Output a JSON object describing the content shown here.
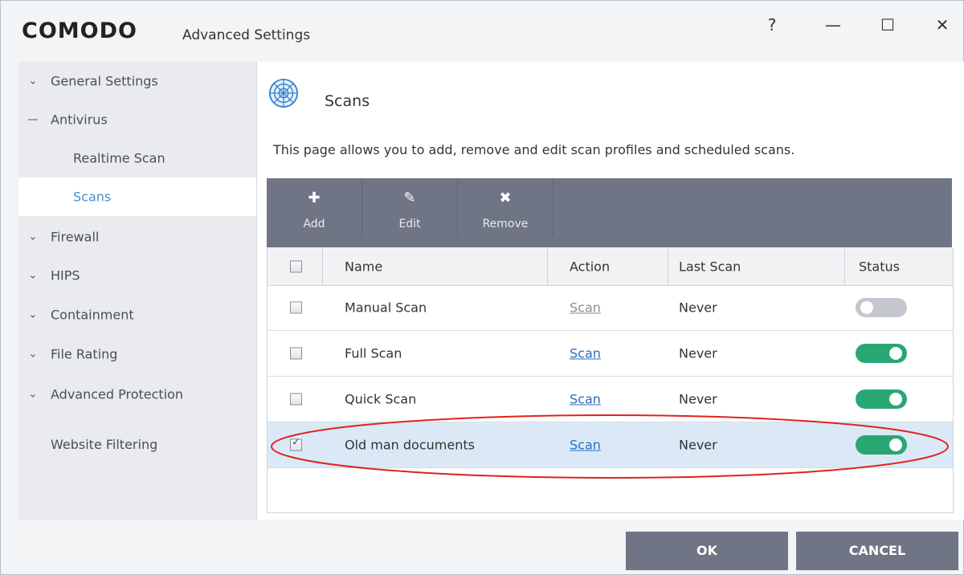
{
  "window": {
    "logo": "COMODO",
    "subtitle": "Advanced Settings",
    "controls": {
      "help": "?",
      "minimize": "—",
      "maximize": "☐",
      "close": "✕"
    }
  },
  "sidebar": {
    "items": [
      {
        "label": "General Settings",
        "icon": "chevron-down-icon",
        "glyph": "⌄"
      },
      {
        "label": "Antivirus",
        "icon": "collapse-dash-icon",
        "glyph": "—"
      },
      {
        "label": "Realtime Scan"
      },
      {
        "label": "Scans"
      },
      {
        "label": "Firewall",
        "icon": "chevron-down-icon",
        "glyph": "⌄"
      },
      {
        "label": "HIPS",
        "icon": "chevron-down-icon",
        "glyph": "⌄"
      },
      {
        "label": "Containment",
        "icon": "chevron-down-icon",
        "glyph": "⌄"
      },
      {
        "label": "File Rating",
        "icon": "chevron-down-icon",
        "glyph": "⌄"
      },
      {
        "label": "Advanced Protection",
        "icon": "chevron-down-icon",
        "glyph": "⌄"
      },
      {
        "label": "Website Filtering"
      }
    ],
    "active": "Scans"
  },
  "main": {
    "title": "Scans",
    "description": "This page allows you to add, remove and edit scan profiles and scheduled scans.",
    "toolbar": [
      {
        "label": "Add",
        "icon": "plus-icon",
        "glyph": "✚"
      },
      {
        "label": "Edit",
        "icon": "pencil-icon",
        "glyph": "✎"
      },
      {
        "label": "Remove",
        "icon": "x-icon",
        "glyph": "✖"
      }
    ],
    "table": {
      "columns": [
        "Name",
        "Action",
        "Last Scan",
        "Status"
      ],
      "rows": [
        {
          "name": "Manual Scan",
          "action": "Scan",
          "last_scan": "Never",
          "status": "off",
          "checked": false
        },
        {
          "name": "Full Scan",
          "action": "Scan",
          "last_scan": "Never",
          "status": "on",
          "checked": false
        },
        {
          "name": "Quick Scan",
          "action": "Scan",
          "last_scan": "Never",
          "status": "on",
          "checked": false
        },
        {
          "name": "Old man documents",
          "action": "Scan",
          "last_scan": "Never",
          "status": "on",
          "checked": true,
          "selected": true
        }
      ]
    }
  },
  "footer": {
    "ok": "OK",
    "cancel": "CANCEL"
  },
  "colors": {
    "toolbar": "#6f7584",
    "accent_blue": "#4b8fd0",
    "toggle_on": "#29a773",
    "toggle_off": "#c4c7cd",
    "highlight_ellipse": "#e0231b",
    "selected_row": "#dbe9f7"
  }
}
